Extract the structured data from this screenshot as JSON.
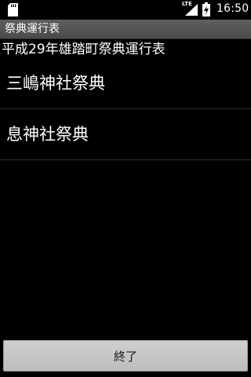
{
  "status_bar": {
    "left_icon": "sd-card-icon",
    "network_type": "LTE",
    "signal_icon": "signal-icon",
    "battery_icon": "battery-charging-icon",
    "time": "16:50"
  },
  "title_bar": {
    "title": "祭典運行表"
  },
  "header": {
    "text": "平成29年雄踏町祭典運行表"
  },
  "list": {
    "items": [
      {
        "label": "三嶋神社祭典"
      },
      {
        "label": "息神社祭典"
      }
    ]
  },
  "footer": {
    "exit_label": "終了"
  },
  "colors": {
    "background": "#000000",
    "title_bar": "#555555",
    "button": "#c8c8c8",
    "divider": "#2e2e2e"
  }
}
